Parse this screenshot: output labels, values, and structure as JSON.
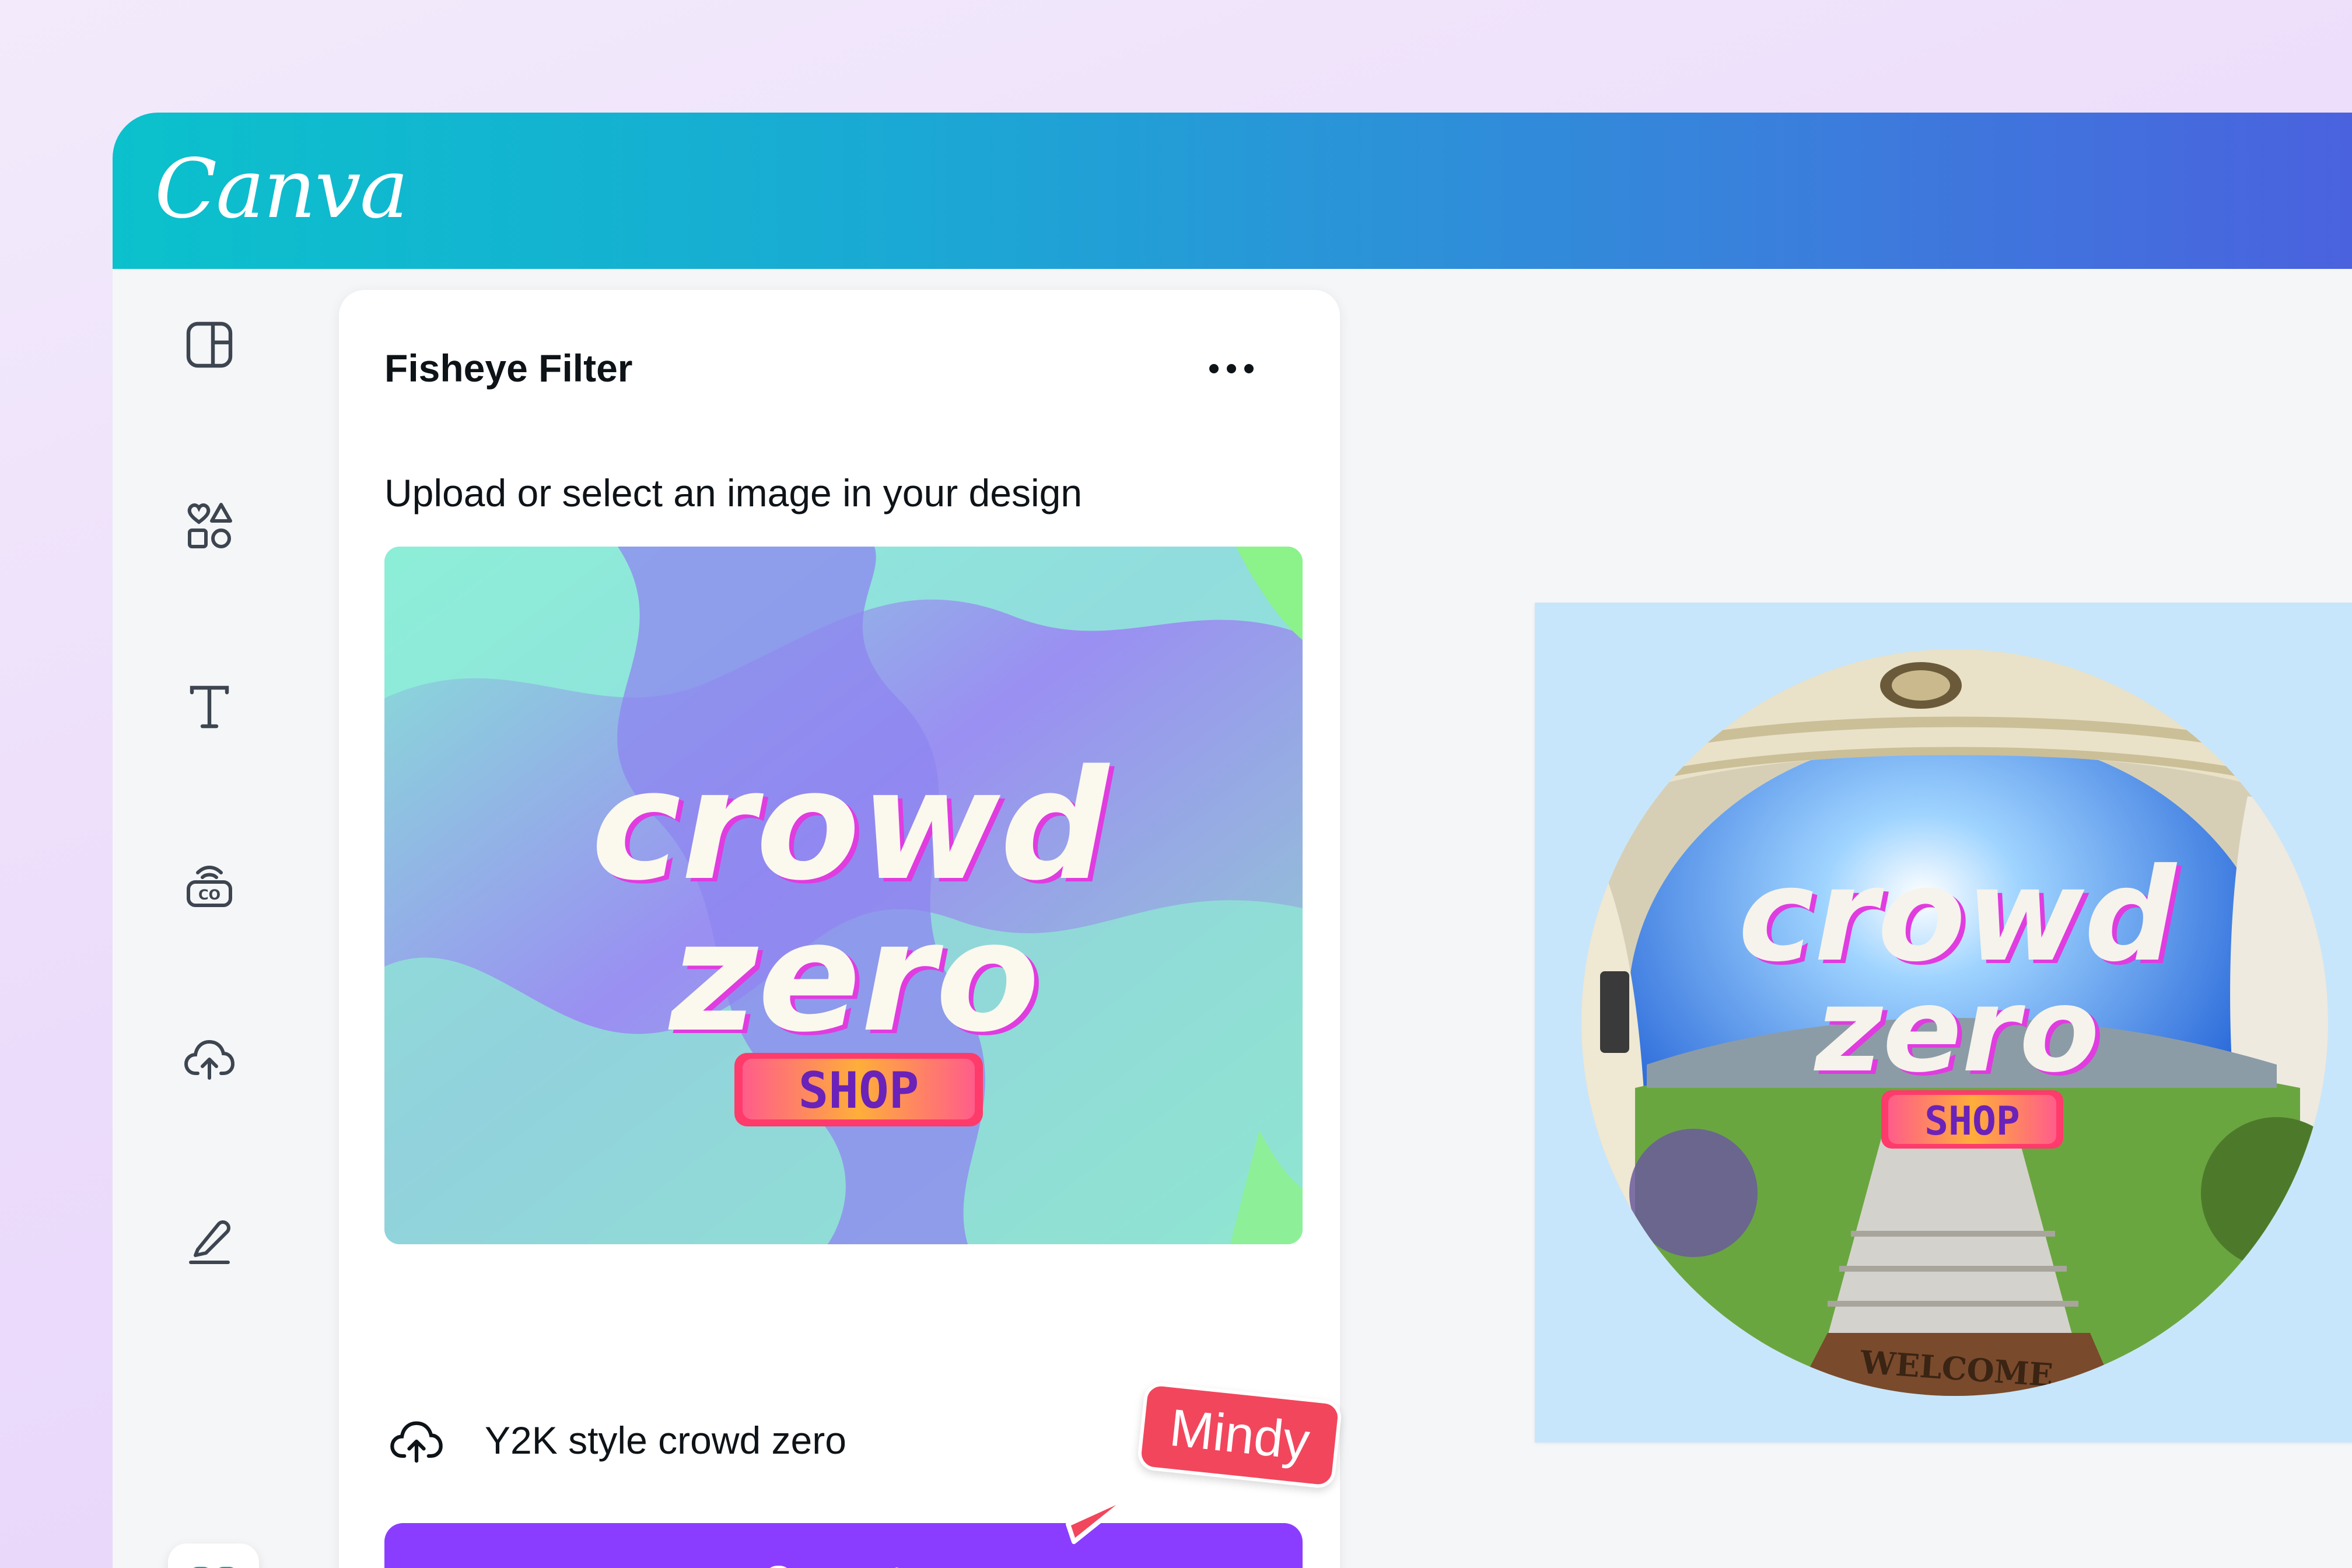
{
  "brand": {
    "logo_text": "Canva"
  },
  "rail": {
    "items": [
      {
        "name": "design",
        "icon": "layout-icon"
      },
      {
        "name": "elements",
        "icon": "shapes-icon"
      },
      {
        "name": "text",
        "icon": "text-icon"
      },
      {
        "name": "brand",
        "icon": "brand-kit-icon"
      },
      {
        "name": "uploads",
        "icon": "cloud-upload-icon"
      },
      {
        "name": "draw",
        "icon": "pen-icon"
      },
      {
        "name": "apps",
        "icon": "apps-add-icon",
        "active": true
      }
    ]
  },
  "panel": {
    "title": "Fisheye Filter",
    "subtitle": "Upload or select an image in your design",
    "preview": {
      "line1": "crowd",
      "line2": "zero",
      "badge": "SHOP"
    },
    "file": {
      "name": "Y2K style crowd zero"
    },
    "generate_label": "Generate"
  },
  "collaborator": {
    "name": "Mindy",
    "color": "#f2465d"
  },
  "canvas": {
    "background": "#c8e6fb",
    "result": {
      "line1": "crowd",
      "line2": "zero",
      "badge": "SHOP",
      "mat_text": "WELCOME"
    }
  },
  "colors": {
    "accent": "#8b3dff",
    "header_start": "#0bc1cc",
    "header_end": "#4a62de"
  }
}
